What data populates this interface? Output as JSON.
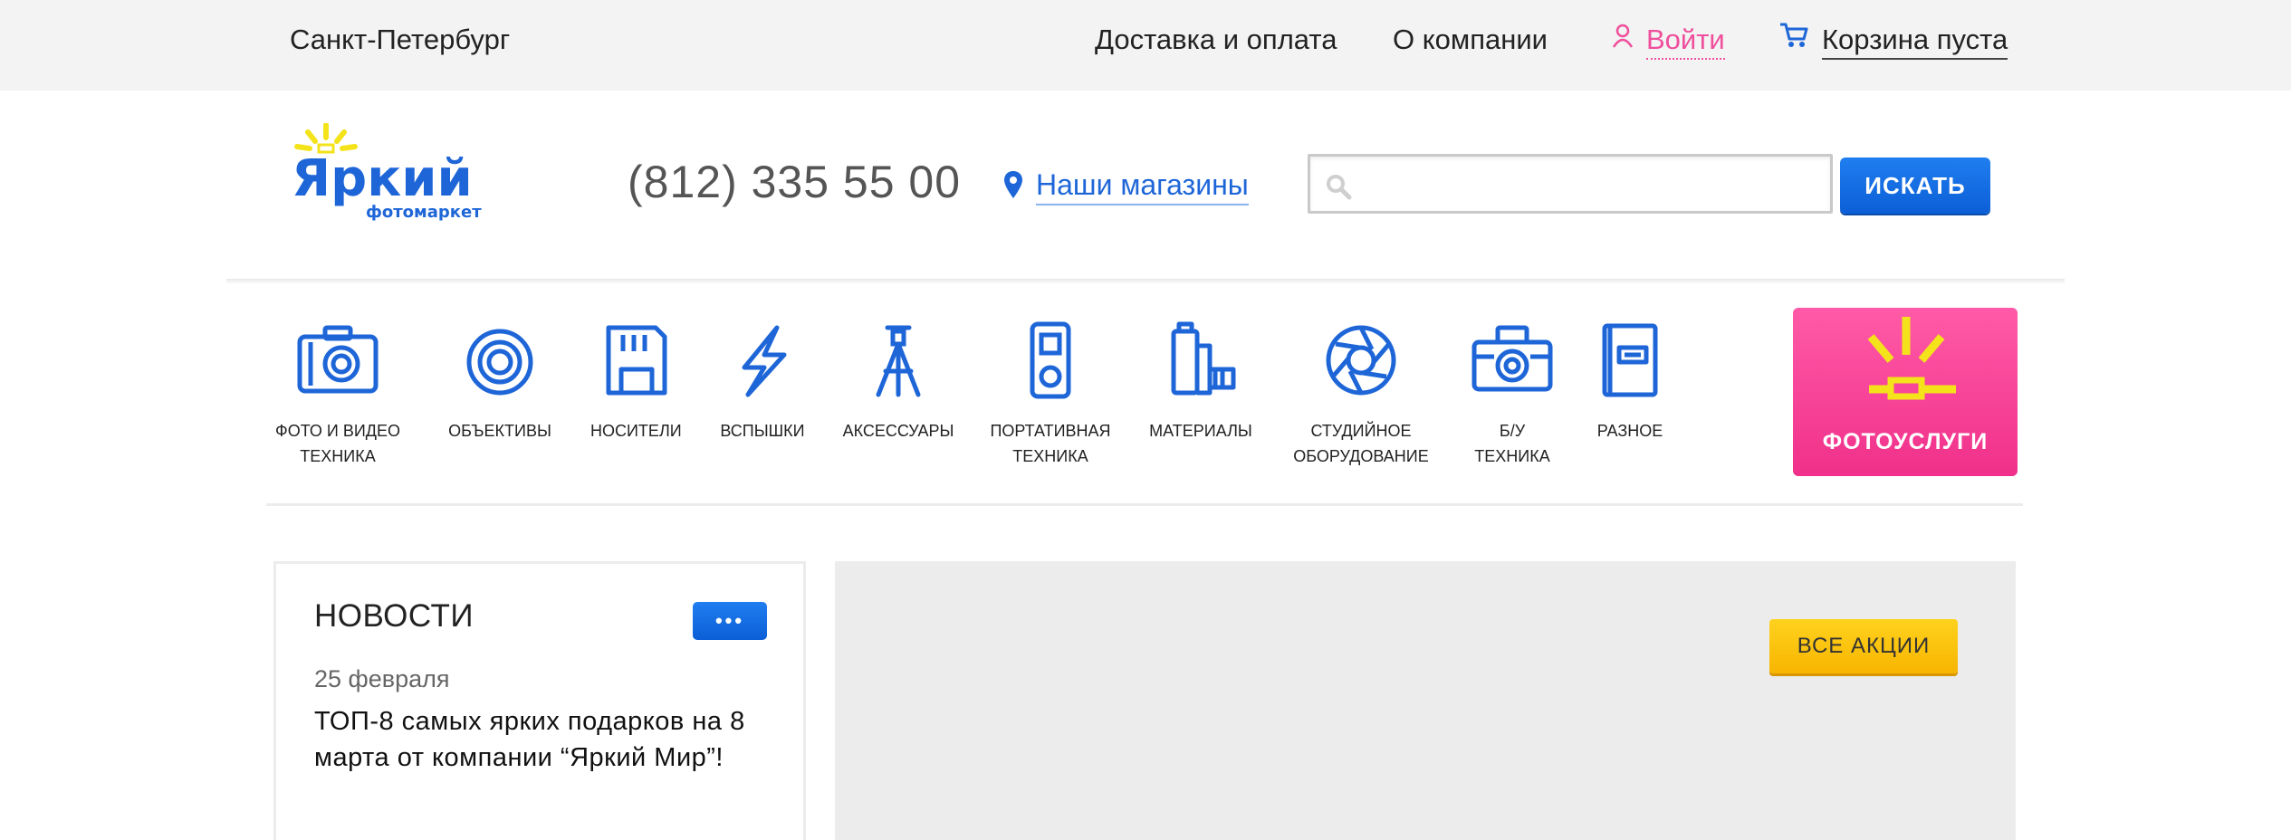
{
  "topbar": {
    "city": "Санкт-Петербург",
    "nav": [
      "Доставка и оплата",
      "О компании"
    ],
    "login": "Войти",
    "cart": "Корзина пуста"
  },
  "header": {
    "logo_text": "Яркий",
    "logo_sub": "фотомаркет",
    "phone": "(812) 335 55 00",
    "stores": "Наши магазины",
    "search_placeholder": "",
    "search_button": "ИСКАТЬ"
  },
  "categories": [
    {
      "label": "ФОТО И ВИДЕО\nТЕХНИКА",
      "icon": "camera-icon"
    },
    {
      "label": "ОБЪЕКТИВЫ",
      "icon": "lens-icon"
    },
    {
      "label": "НОСИТЕЛИ",
      "icon": "memory-card-icon"
    },
    {
      "label": "ВСПЫШКИ",
      "icon": "flash-icon"
    },
    {
      "label": "АКСЕССУАРЫ",
      "icon": "tripod-icon"
    },
    {
      "label": "ПОРТАТИВНАЯ\nТЕХНИКА",
      "icon": "media-player-icon"
    },
    {
      "label": "МАТЕРИАЛЫ",
      "icon": "film-icon"
    },
    {
      "label": "СТУДИЙНОЕ\nОБОРУДОВАНИЕ",
      "icon": "aperture-icon"
    },
    {
      "label": "Б/У\nТЕХНИКА",
      "icon": "used-camera-icon"
    },
    {
      "label": "РАЗНОЕ",
      "icon": "book-icon"
    }
  ],
  "photo_services": "ФОТОУСЛУГИ",
  "news": {
    "title": "НОВОСТИ",
    "more": "•••",
    "date": "25 февраля",
    "headline": "ТОП-8 самых ярких подарков на 8 марта от компании “Яркий Мир”!"
  },
  "promo": {
    "all_button": "ВСЕ АКЦИИ"
  },
  "colors": {
    "brand_blue": "#1e66d8",
    "accent_pink": "#ef4f9c",
    "accent_yellow": "#ffd21e",
    "topbar_bg": "#f3f3f3"
  }
}
